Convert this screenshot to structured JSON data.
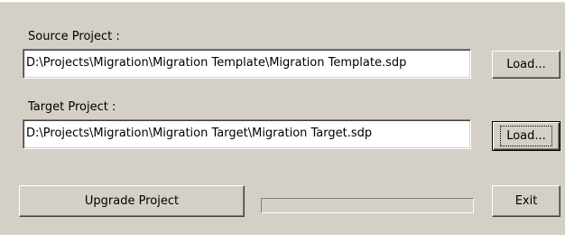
{
  "source": {
    "label": "Source Project :",
    "path": "D:\\Projects\\Migration\\Migration Template\\Migration Template.sdp",
    "load_label": "Load..."
  },
  "target": {
    "label": "Target Project :",
    "path": "D:\\Projects\\Migration\\Migration Target\\Migration Target.sdp",
    "load_label": "Load..."
  },
  "actions": {
    "upgrade_label": "Upgrade Project",
    "exit_label": "Exit"
  },
  "progress": {
    "fraction": 0
  }
}
